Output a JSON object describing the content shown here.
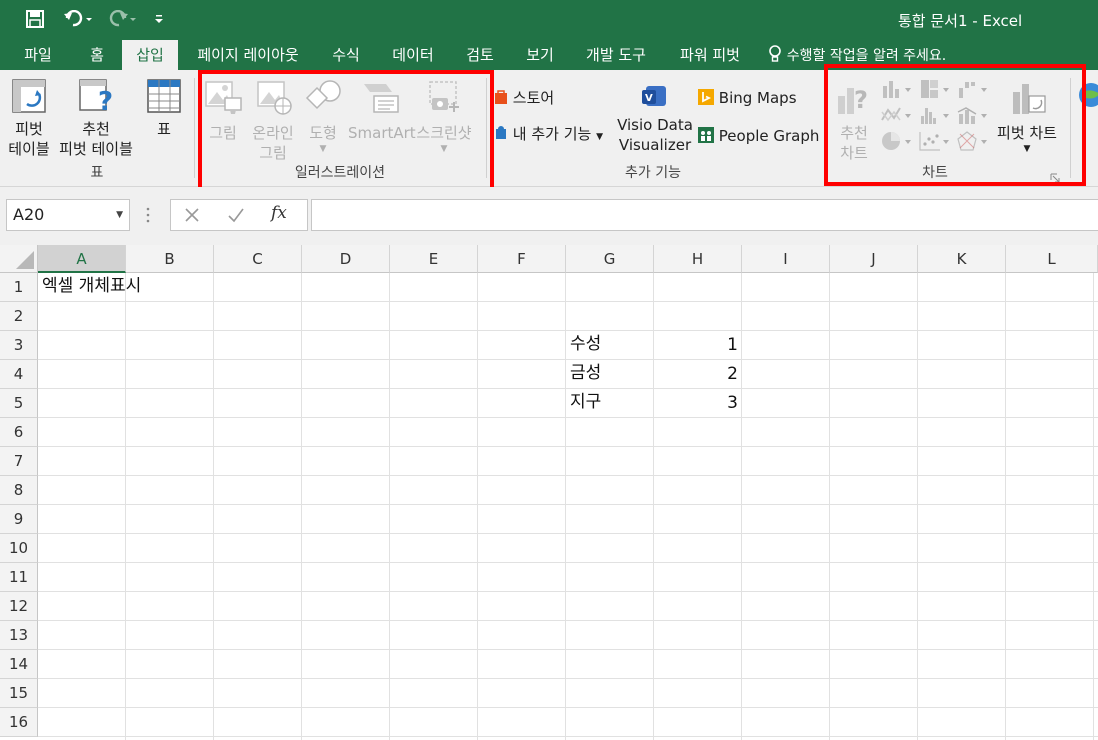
{
  "window": {
    "title": "통합 문서1 - Excel"
  },
  "tabs": [
    "파일",
    "홈",
    "삽입",
    "페이지 레이아웃",
    "수식",
    "데이터",
    "검토",
    "보기",
    "개발 도구",
    "파워 피벗"
  ],
  "tell_me": "수행할 작업을 알려 주세요.",
  "ribbon": {
    "table_group": {
      "label": "표",
      "pivot_table": [
        "피벗",
        "테이블"
      ],
      "recommended_pivot": [
        "추천",
        "피벗 테이블"
      ],
      "table": "표"
    },
    "illustrations_group": {
      "label": "일러스트레이션",
      "picture": "그림",
      "online_picture": [
        "온라인",
        "그림"
      ],
      "shapes": "도형",
      "smartart": "SmartArt",
      "screenshot": "스크린샷"
    },
    "addins_group": {
      "label": "추가 기능",
      "store": "스토어",
      "my_addins": "내 추가 기능",
      "visio": [
        "Visio Data",
        "Visualizer"
      ],
      "bing_maps": "Bing Maps",
      "people_graph": "People Graph"
    },
    "charts_group": {
      "label": "차트",
      "recommended_charts": [
        "추천",
        "차트"
      ],
      "pivot_chart": "피벗 차트"
    }
  },
  "formula_bar": {
    "name_box": "A20",
    "fx": "fx",
    "value": ""
  },
  "columns": [
    "A",
    "B",
    "C",
    "D",
    "E",
    "F",
    "G",
    "H",
    "I",
    "J",
    "K",
    "L"
  ],
  "rows": [
    "1",
    "2",
    "3",
    "4",
    "5",
    "6",
    "7",
    "8",
    "9",
    "10",
    "11",
    "12",
    "13",
    "14",
    "15",
    "16"
  ],
  "cells": {
    "A1": "엑셀 개체표시",
    "G3": "수성",
    "H3": "1",
    "G4": "금성",
    "H4": "2",
    "G5": "지구",
    "H5": "3"
  },
  "colors": {
    "excel_green": "#217346",
    "highlight_red": "#ff0000"
  }
}
